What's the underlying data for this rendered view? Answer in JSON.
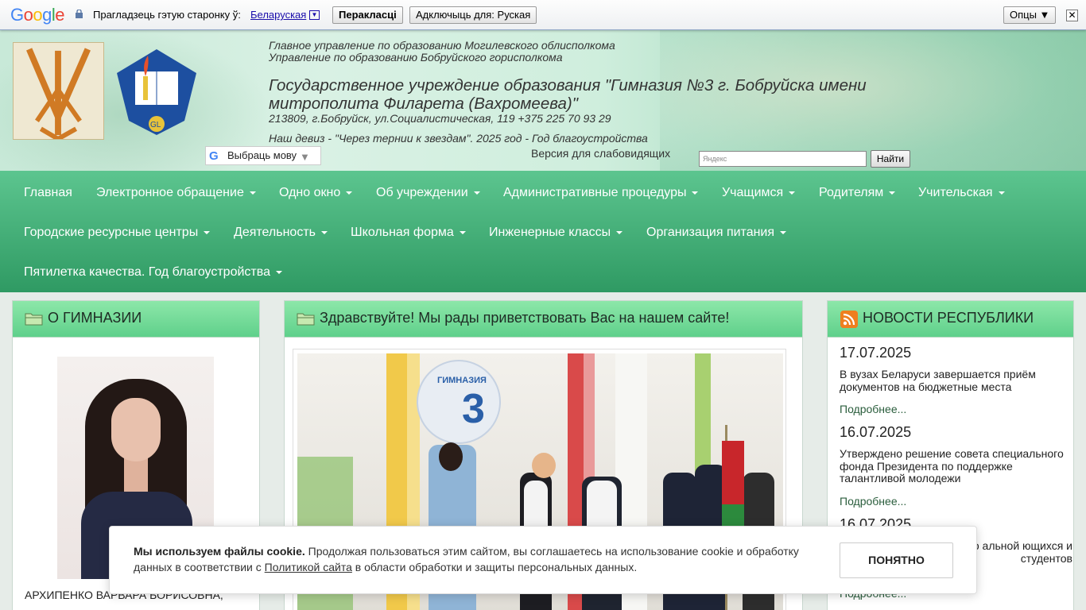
{
  "translate_bar": {
    "logo": "Google",
    "prompt": "Прагладзець гэтую старонку ў:",
    "language": "Беларуская",
    "translate_button": "Перакласці",
    "disable_button": "Адключыць для: Руская",
    "options_button": "Опцы ▼",
    "close_glyph": "✕"
  },
  "header": {
    "line1": "Главное управление по образованию Могилевского облисполкома",
    "line2": "Управление по образованию Бобруйского горисполкома",
    "title": "Государственное учреждение образования \"Гимназия №3 г. Бобруйска имени митрополита Филарета (Вахромеева)\"",
    "address": "213809, г.Бобруйск, ул.Социалистическая, 119 +375 225 70 93 29",
    "motto": "Наш девиз - \"Через тернии к звездам\". 2025 год - Год благоустройства",
    "vision_link": "Версия для слабовидящих",
    "lang_select": "Выбраць мову",
    "lang_select_arrow": "▼",
    "search_placeholder": "Яндекс",
    "search_button": "Найти"
  },
  "nav": {
    "row1": [
      "Главная",
      "Электронное обращение",
      "Одно окно",
      "Об учреждении",
      "Административные процедуры",
      "Учащимся",
      "Родителям",
      "Учительская"
    ],
    "row2": [
      "Городские ресурсные центры",
      "Деятельность",
      "Школьная форма",
      "Инженерные классы",
      "Организация питания"
    ],
    "row3": [
      "Пятилетка качества. Год благоустройства"
    ]
  },
  "left_panel": {
    "title": "О ГИМНАЗИИ",
    "person_name": "АРХИПЕНКО ВАРВАРА БОРИСОВНА,"
  },
  "mid_panel": {
    "title": "Здравствуйте! Мы рады приветствовать Вас на нашем сайте!",
    "photo_sign": "ГИМНАЗИЯ",
    "photo_sign_number": "3"
  },
  "right_panel": {
    "title": "НОВОСТИ РЕСПУБЛИКИ",
    "news": [
      {
        "date": "17.07.2025",
        "text": "В вузах Беларуси завершается приём документов на бюджетные места",
        "more": "Подробнее..."
      },
      {
        "date": "16.07.2025",
        "text": "Утверждено решение совета специального фонда Президента по поддержке талантливой молодежи",
        "more": "Подробнее..."
      },
      {
        "date": "16.07.2025",
        "text": "та специального альной ющихся и студентов",
        "more": "Подробнее..."
      }
    ]
  },
  "cookie": {
    "bold": "Мы используем файлы cookie.",
    "text1": " Продолжая пользоваться этим сайтом, вы соглашаетесь на использование cookie и обработку данных в соответствии с ",
    "link": "Политикой сайта",
    "text2": " в области обработки и защиты персональных данных.",
    "button": "ПОНЯТНО"
  }
}
